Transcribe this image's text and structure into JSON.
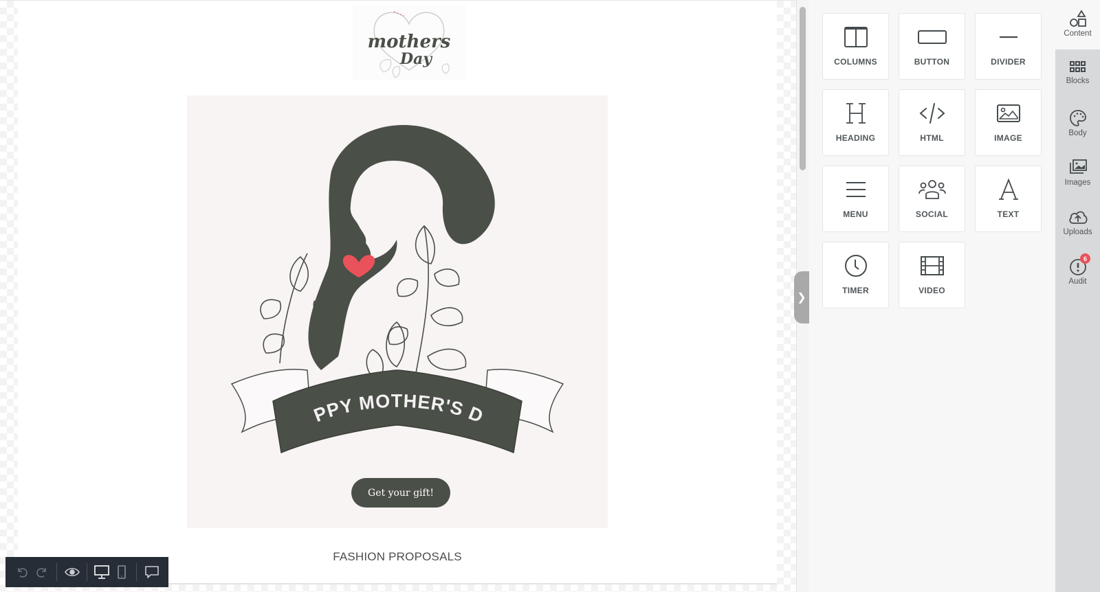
{
  "email": {
    "logo_alt": "Mother's Day",
    "hero_banner_text": "HAPPY MOTHER'S DAY",
    "cta_label": "Get your gift!",
    "section_title": "FASHION PROPOSALS"
  },
  "colors": {
    "hero_dark": "#4a4f48",
    "heart_red": "#e9525a",
    "hero_bg": "#f8f4f4",
    "toolbar_bg": "#272d36",
    "badge_red": "#e9525a"
  },
  "content_tools": [
    {
      "label": "COLUMNS",
      "icon": "columns-icon"
    },
    {
      "label": "BUTTON",
      "icon": "button-icon"
    },
    {
      "label": "DIVIDER",
      "icon": "divider-icon"
    },
    {
      "label": "HEADING",
      "icon": "heading-icon"
    },
    {
      "label": "HTML",
      "icon": "html-code-icon"
    },
    {
      "label": "IMAGE",
      "icon": "image-icon"
    },
    {
      "label": "MENU",
      "icon": "menu-icon"
    },
    {
      "label": "SOCIAL",
      "icon": "social-icon"
    },
    {
      "label": "TEXT",
      "icon": "text-icon"
    },
    {
      "label": "TIMER",
      "icon": "timer-icon"
    },
    {
      "label": "VIDEO",
      "icon": "video-icon"
    }
  ],
  "rail": [
    {
      "label": "Content",
      "icon": "shapes-icon",
      "active": true
    },
    {
      "label": "Blocks",
      "icon": "grid-icon"
    },
    {
      "label": "Body",
      "icon": "palette-icon"
    },
    {
      "label": "Images",
      "icon": "images-icon"
    },
    {
      "label": "Uploads",
      "icon": "cloud-upload-icon"
    },
    {
      "label": "Audit",
      "icon": "alert-icon",
      "badge": "6"
    }
  ],
  "toolbar": {
    "undo": "undo-icon",
    "redo": "redo-icon",
    "preview": "eye-icon",
    "desktop": "desktop-icon",
    "mobile": "mobile-icon",
    "comments": "comment-icon"
  }
}
